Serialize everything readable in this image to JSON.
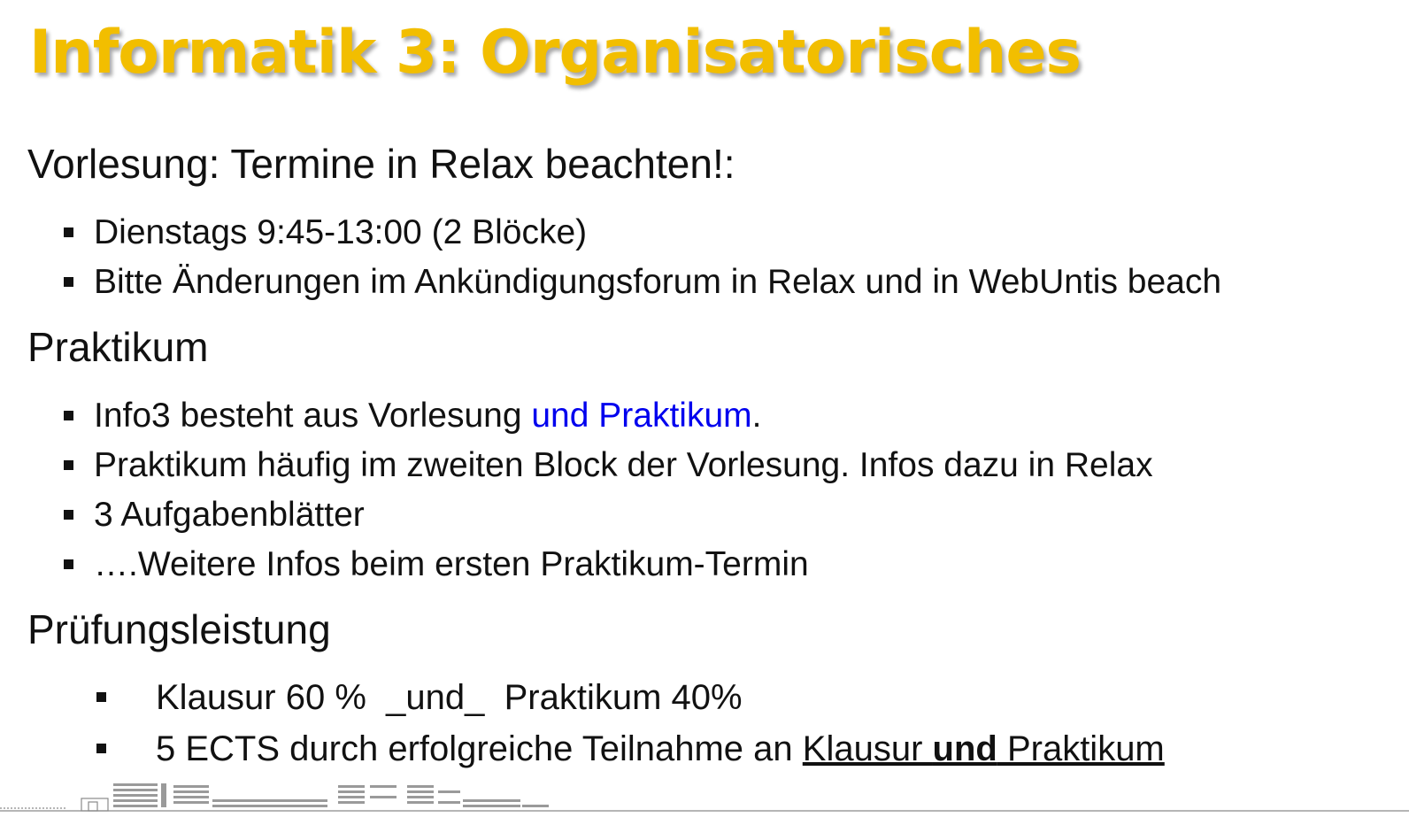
{
  "slide": {
    "title": "Informatik 3: Organisatorisches",
    "sections": {
      "vorlesung": {
        "heading": "Vorlesung: Termine in Relax beachten!:",
        "bullets": [
          "Dienstags 9:45-13:00 (2 Blöcke)",
          "Bitte Änderungen im Ankündigungsforum in Relax und in WebUntis beach"
        ]
      },
      "praktikum": {
        "heading": "Praktikum",
        "bullet1_plain": "Info3 besteht aus Vorlesung ",
        "bullet1_link": "und Praktikum",
        "bullet1_end": ".",
        "bullets": [
          "Praktikum häufig im zweiten Block der Vorlesung. Infos dazu in Relax",
          "3 Aufgabenblätter",
          "….Weitere Infos beim ersten Praktikum-Termin"
        ]
      },
      "pruefung": {
        "heading": "Prüfungsleistung",
        "bullet1": "Klausur 60 %  _und_  Praktikum 40%",
        "bullet2_pre": "5 ECTS durch erfolgreiche Teilnahme an ",
        "bullet2_u1": "Klausur ",
        "bullet2_bold": "und",
        "bullet2_u2": " Praktikum"
      }
    },
    "colors": {
      "title": "#F2BE00",
      "link": "#0000EE",
      "text": "#111111"
    }
  }
}
